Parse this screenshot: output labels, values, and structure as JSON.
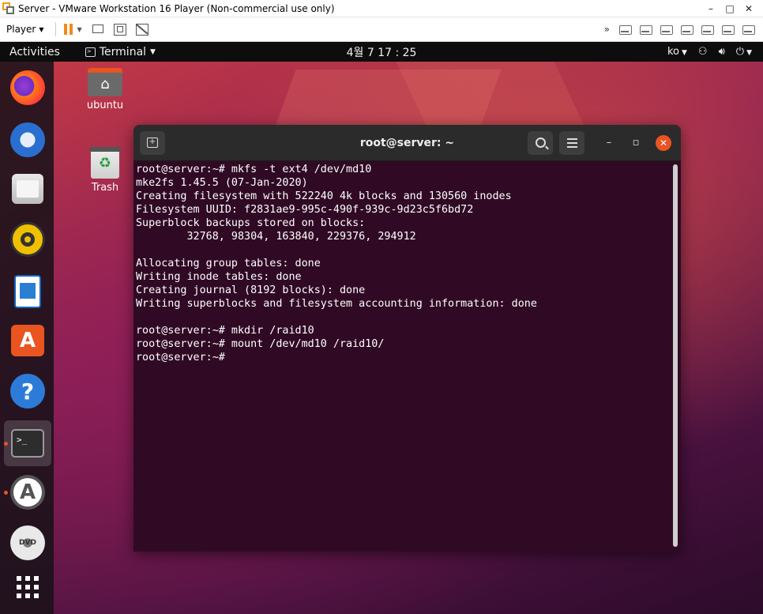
{
  "vmware": {
    "title": "Server - VMware Workstation 16 Player (Non-commercial use only)",
    "window_buttons": [
      "–",
      "□",
      "✕"
    ],
    "player_menu": "Player",
    "more_chevron": "»"
  },
  "topbar": {
    "activities": "Activities",
    "app_menu": "Terminal",
    "clock": "4월 7  17 : 25",
    "input_method": "ko"
  },
  "desktop": {
    "icons": [
      {
        "label": "ubuntu"
      },
      {
        "label": "Trash"
      }
    ]
  },
  "dock": {
    "items": [
      "firefox",
      "thunderbird",
      "files",
      "rhythmbox",
      "libreoffice-writer",
      "ubuntu-software",
      "help",
      "terminal",
      "software-updater",
      "dvd",
      "show-applications"
    ],
    "help_glyph": "?",
    "software_glyph": "A",
    "updater_glyph": "A",
    "dvd_label": "DVD",
    "terminal_glyph": ">_"
  },
  "terminal": {
    "title": "root@server: ~",
    "lines": [
      "root@server:~# mkfs -t ext4 /dev/md10",
      "mke2fs 1.45.5 (07-Jan-2020)",
      "Creating filesystem with 522240 4k blocks and 130560 inodes",
      "Filesystem UUID: f2831ae9-995c-490f-939c-9d23c5f6bd72",
      "Superblock backups stored on blocks:",
      "        32768, 98304, 163840, 229376, 294912",
      "",
      "Allocating group tables: done",
      "Writing inode tables: done",
      "Creating journal (8192 blocks): done",
      "Writing superblocks and filesystem accounting information: done",
      "",
      "root@server:~# mkdir /raid10",
      "root@server:~# mount /dev/md10 /raid10/",
      "root@server:~#"
    ]
  },
  "colors": {
    "ubuntu_orange": "#e95420",
    "terminal_bg": "#300a24",
    "vmware_accent": "#f08a1c"
  }
}
